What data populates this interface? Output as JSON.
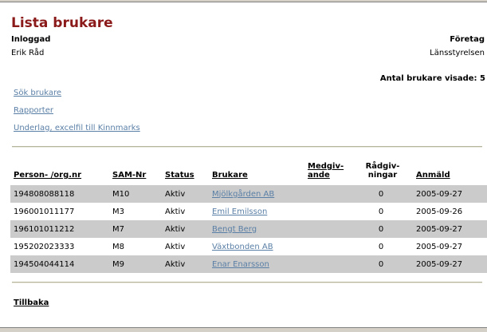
{
  "page": {
    "title": "Lista brukare"
  },
  "session": {
    "logged_in_label": "Inloggad",
    "logged_in_user": "Erik Råd",
    "company_label": "Företag",
    "company_value": "Länsstyrelsen",
    "shown_count_text": "Antal brukare visade: 5"
  },
  "links": {
    "search": "Sök brukare",
    "reports": "Rapporter",
    "excel": "Underlag, excelfil till Kinnmarks"
  },
  "table": {
    "headers": {
      "person": "Person- /org.nr",
      "sam": "SAM-Nr",
      "status": "Status",
      "brukare": "Brukare",
      "medgiv_1": "Medgiv-",
      "medgiv_2": "ande",
      "radgiv_1": "Rådgiv-",
      "radgiv_2": "ningar",
      "anmald": "Anmäld"
    },
    "rows": [
      {
        "person": "194808088118",
        "sam": "M10",
        "status": "Aktiv",
        "brukare": "Mjölkgården AB",
        "medgivande": "",
        "radgivningar": "0",
        "anmald": "2005-09-27"
      },
      {
        "person": "196001011177",
        "sam": "M3",
        "status": "Aktiv",
        "brukare": "Emil Emilsson",
        "medgivande": "",
        "radgivningar": "0",
        "anmald": "2005-09-26"
      },
      {
        "person": "196101011212",
        "sam": "M7",
        "status": "Aktiv",
        "brukare": "Bengt Berg",
        "medgivande": "",
        "radgivningar": "0",
        "anmald": "2005-09-27"
      },
      {
        "person": "195202023333",
        "sam": "M8",
        "status": "Aktiv",
        "brukare": "Växtbonden AB",
        "medgivande": "",
        "radgivningar": "0",
        "anmald": "2005-09-27"
      },
      {
        "person": "194504044114",
        "sam": "M9",
        "status": "Aktiv",
        "brukare": "Enar Enarsson",
        "medgivande": "",
        "radgivningar": "0",
        "anmald": "2005-09-27"
      }
    ]
  },
  "footer": {
    "back": "Tillbaka"
  },
  "colors": {
    "title": "#8b1a1a",
    "link": "#5a7fa6",
    "row_shaded": "#cbcbcb"
  }
}
